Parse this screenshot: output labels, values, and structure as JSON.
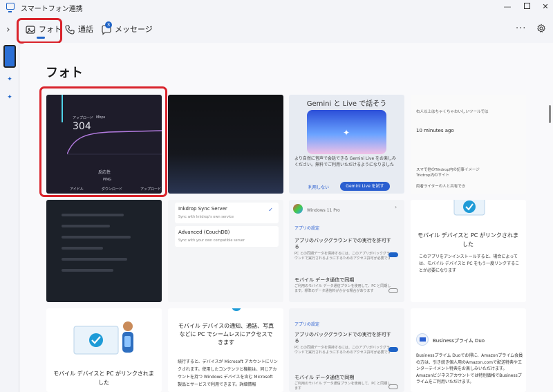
{
  "window": {
    "title": "スマートフォン連携"
  },
  "nav": {
    "tabs": [
      {
        "label": "フォト",
        "icon": "photo-icon",
        "selected": true
      },
      {
        "label": "通話",
        "icon": "phone-icon"
      },
      {
        "label": "メッセージ",
        "icon": "message-icon",
        "badge": "3"
      }
    ]
  },
  "main": {
    "title": "フォト"
  },
  "photos": {
    "speed": {
      "upload_label": "アップロード",
      "upload_value": "304",
      "unit": "Mbps",
      "response_label": "反応性",
      "ping": "PING",
      "legend": [
        "アイドル",
        "ダウンロード",
        "アップロード"
      ]
    },
    "gemini": {
      "title": "Gemini と Live で話そう",
      "body": "より自然に音声で会話できる Gemini Live をお楽しみください。無料でご利用いただけるようになりました",
      "cancel": "利用しない",
      "try": "Gemini Live を試す"
    },
    "chat": {
      "line1": "右人以上はちゃくちゃおいしいツールでは",
      "time": "10 minutes ago",
      "line2": "スマで他のTrkdrop内の記事イメージ",
      "line3": "Trkdrop内のサイト",
      "line4": "両者ライターの人と共有でき"
    },
    "inkdrop": {
      "option1": "Inkdrop Sync Server",
      "option1_sub": "Sync with Inkdrop's own service",
      "option2": "Advanced (CouchDB)",
      "option2_sub": "Sync with your own compatible server"
    },
    "settings1": {
      "device": "Windows 11 Pro",
      "section": "アプリの設定",
      "item1": "アプリのバックグラウンドでの実行を許可する",
      "item1_sub": "PC との同期データを保持するには、このアプリがバックグラウンドで実行されるようにするためのアクセス許可が必要です",
      "item2": "モバイル データ通信で同期",
      "item2_sub": "ご利用のモバイル データ通信プランを使用して、PC と同期します。標準のデータ通信料がかかる場合があります"
    },
    "link_card": {
      "text": "モバイル デバイスと PC がリンクされました",
      "sub": "このアプリをアンインストールすると、場合によっては、モバイル デバイスと PC をもう一度リンクすることが必要になります"
    },
    "link_card2": {
      "text": "モバイル デバイスと PC がリンクされました"
    },
    "notice": {
      "heading": "モバイル デバイスの通知、通話、写真などに PC でシームレスにアクセスできます",
      "body": "続行すると、デバイスが Microsoft アカウントにリンクされます。使用したコンテンツと機能は、同じアカウントを持つ Windows デバイスを含む Microsoft 製品とサービスで利用できます。詳細情報"
    },
    "settings2": {
      "section": "アプリの設定",
      "item1": "アプリのバックグラウンドでの実行を許可する",
      "item1_sub": "PC との同期データを保持するには、このアプリがバックグラウンドで実行されるようにするためのアクセス許可が必要です",
      "item2": "モバイル データ通信で同期",
      "item2_sub": "ご利用のモバイル データ通信プランを使用して、PC と同期します"
    },
    "amazon": {
      "brand": "Businessプライム Duo",
      "body": "Businessプライム Duoでお得に、Amazonプライム会員の方は、引き続き個人用のAmazon.comで配送特典やエンターテイメント特典をお楽しみいただけます。Amazonビジネスアカウントでは特別価格でBusinessプライムをご利用いただけます。"
    }
  }
}
